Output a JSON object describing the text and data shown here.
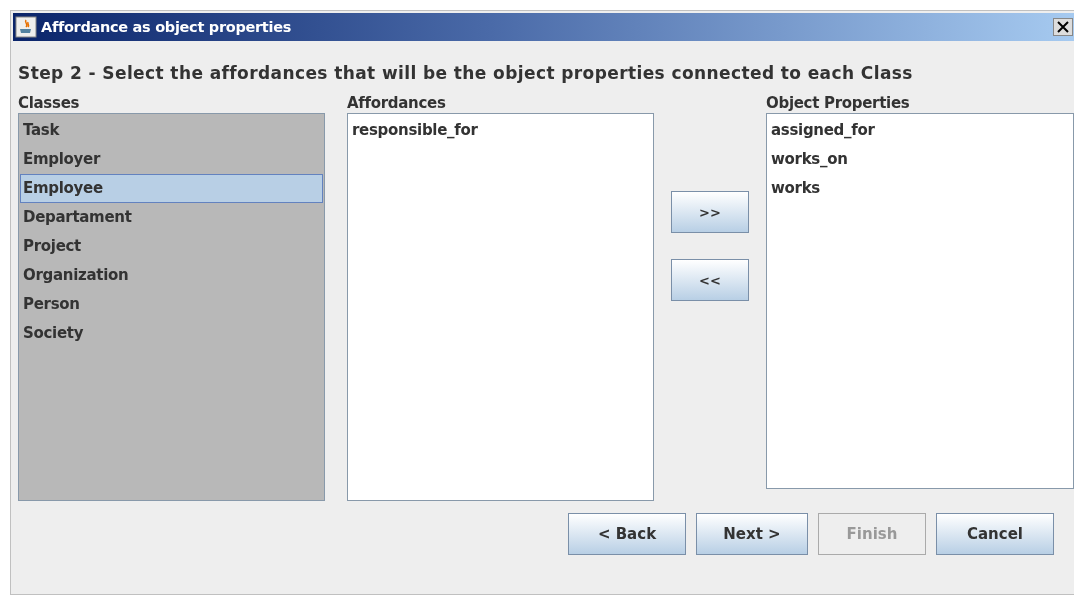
{
  "window": {
    "title": "Affordance as object properties"
  },
  "heading": "Step 2 - Select the affordances that will be the object properties connected to each Class",
  "classes": {
    "label": "Classes",
    "items": [
      {
        "text": "Task",
        "selected": false
      },
      {
        "text": "Employer",
        "selected": false
      },
      {
        "text": "Employee",
        "selected": true
      },
      {
        "text": "Departament",
        "selected": false
      },
      {
        "text": "Project",
        "selected": false
      },
      {
        "text": "Organization",
        "selected": false
      },
      {
        "text": "Person",
        "selected": false
      },
      {
        "text": "Society",
        "selected": false
      }
    ]
  },
  "affordances": {
    "label": "Affordances",
    "items": [
      {
        "text": "responsible_for",
        "selected": false
      }
    ]
  },
  "move_buttons": [
    ">>",
    "<<"
  ],
  "object_properties": {
    "label": "Object Properties",
    "items": [
      {
        "text": "assigned_for",
        "selected": false
      },
      {
        "text": "works_on",
        "selected": false
      },
      {
        "text": "works",
        "selected": false
      }
    ]
  },
  "buttons": [
    {
      "label": "< Back",
      "disabled": false
    },
    {
      "label": "Next >",
      "disabled": false
    },
    {
      "label": "Finish",
      "disabled": true
    },
    {
      "label": "Cancel",
      "disabled": false
    }
  ]
}
